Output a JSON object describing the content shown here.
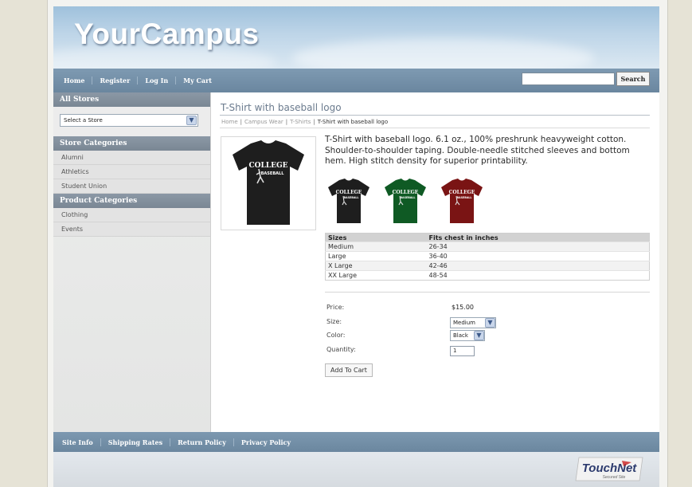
{
  "header": {
    "title": "YourCampus"
  },
  "topnav": {
    "items": [
      "Home",
      "Register",
      "Log In",
      "My Cart"
    ]
  },
  "search": {
    "value": "",
    "button_label": "Search"
  },
  "sidebar": {
    "all_stores_heading": "All Stores",
    "store_select_value": "Select a Store",
    "store_categories_heading": "Store Categories",
    "store_categories": [
      "Alumni",
      "Athletics",
      "Student Union"
    ],
    "product_categories_heading": "Product Categories",
    "product_categories": [
      "Clothing",
      "Events"
    ]
  },
  "product": {
    "title": "T-Shirt with baseball logo",
    "breadcrumb": [
      "Home",
      "Campus Wear",
      "T-Shirts",
      "T-Shirt with baseball logo"
    ],
    "breadcrumb_sep": "|",
    "description": "T-Shirt with baseball logo. 6.1 oz., 100% preshrunk heavyweight cotton. Shoulder-to-shoulder taping. Double-needle stitched sleeves and bottom hem. High stitch density for superior printability.",
    "shirt_print_top": "COLLEGE",
    "shirt_print_bottom": "BASEBALL",
    "colors": {
      "black": "#1e1e1e",
      "green": "#0f5a24",
      "red": "#7a1414"
    },
    "size_table": {
      "headers": [
        "Sizes",
        "Fits chest in inches"
      ],
      "rows": [
        [
          "Medium",
          "26-34"
        ],
        [
          "Large",
          "36-40"
        ],
        [
          "X Large",
          "42-46"
        ],
        [
          "XX Large",
          "48-54"
        ]
      ]
    },
    "form": {
      "price_label": "Price:",
      "price_value": "$15.00",
      "size_label": "Size:",
      "size_value": "Medium",
      "color_label": "Color:",
      "color_value": "Black",
      "quantity_label": "Quantity:",
      "quantity_value": "1",
      "add_button": "Add To Cart"
    }
  },
  "footer": {
    "links": [
      "Site Info",
      "Shipping Rates",
      "Return Policy",
      "Privacy Policy"
    ],
    "logo_text": "TouchNet",
    "logo_sub": "Secured Site"
  }
}
